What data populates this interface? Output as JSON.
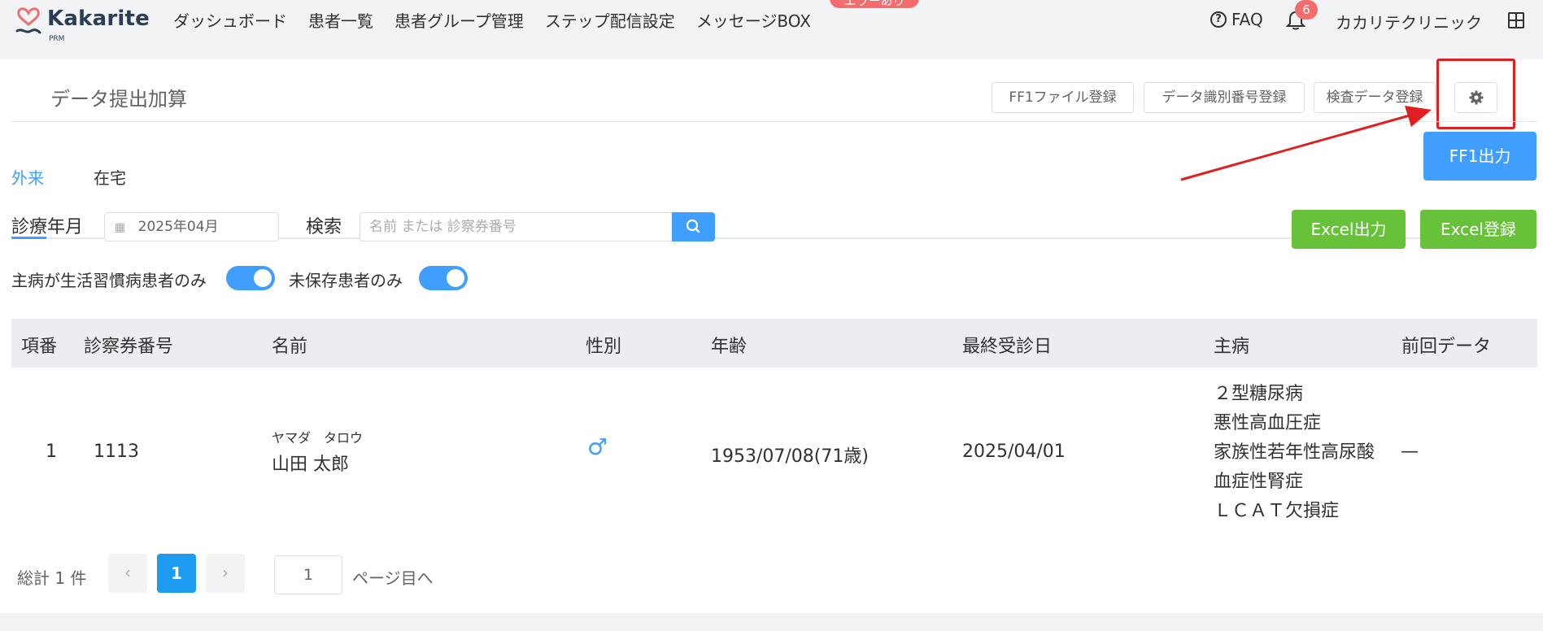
{
  "app": {
    "brand": "Kakarite",
    "brand_sub": "PRM"
  },
  "nav": {
    "items": [
      "ダッシュボード",
      "患者一覧",
      "患者グループ管理",
      "ステップ配信設定",
      "メッセージBOX"
    ],
    "badge_text": "エラーあり",
    "faq": "FAQ",
    "notification_count": "6",
    "clinic_name": "カカリテクリニック"
  },
  "page": {
    "title": "データ提出加算",
    "buttons": {
      "ff1_file_register": "FF1ファイル登録",
      "data_id_register": "データ識別番号登録",
      "exam_data_register": "検査データ登録",
      "ff1_output": "FF1出力",
      "excel_output": "Excel出力",
      "excel_register": "Excel登録"
    }
  },
  "tabs": [
    {
      "label": "外来",
      "active": true
    },
    {
      "label": "在宅",
      "active": false
    }
  ],
  "filters": {
    "month_label": "診療年月",
    "month_value": "2025年04月",
    "search_label": "検索",
    "search_placeholder": "名前 または 診察券番号",
    "toggle1_label": "主病が生活習慣病患者のみ",
    "toggle1_on": true,
    "toggle2_label": "未保存患者のみ",
    "toggle2_on": true
  },
  "table": {
    "headers": [
      "項番",
      "診察券番号",
      "名前",
      "性別",
      "年齢",
      "最終受診日",
      "主病",
      "前回データ"
    ],
    "rows": [
      {
        "no": "1",
        "card_no": "1113",
        "kana": "ヤマダ　タロウ",
        "name": "山田 太郎",
        "gender": "♂",
        "age": "1953/07/08(71歳)",
        "last_visit": "2025/04/01",
        "diseases": [
          "２型糖尿病",
          "悪性高血圧症",
          "家族性若年性高尿酸",
          "血症性腎症",
          "ＬＣＡＴ欠損症"
        ],
        "prev_data": "—"
      }
    ]
  },
  "pagination": {
    "total": "総計 1 件",
    "current_page": "1",
    "prev": "‹",
    "next": "›",
    "goto_value": "1",
    "goto_suffix": "ページ目へ"
  },
  "colors": {
    "primary": "#409eff",
    "success": "#67c23a",
    "highlight": "#e02020"
  }
}
